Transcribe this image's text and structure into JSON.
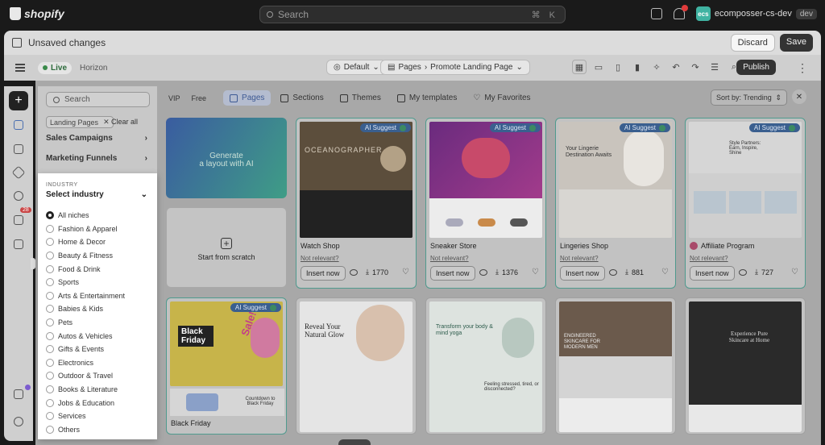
{
  "shopify": {
    "logo_text": "shopify",
    "search_placeholder": "Search",
    "search_shortcut": "⌘ K",
    "store_initials": "ecs",
    "store_name": "ecomposser-cs-dev",
    "env_badge": "dev",
    "notif_count": "1"
  },
  "unsaved": {
    "label": "Unsaved changes",
    "discard": "Discard",
    "save": "Save"
  },
  "editor": {
    "live": "Live",
    "theme": "Horizon",
    "view": "Default",
    "pages": "Pages",
    "page": "Promote Landing Page",
    "publish": "Publish"
  },
  "rail": {
    "badge": "28"
  },
  "filters": {
    "search_placeholder": "Search",
    "chip": "Landing Pages",
    "clear_all": "Clear all",
    "categories": [
      "Sales Campaigns",
      "Marketing Funnels"
    ],
    "industry_label": "INDUSTRY",
    "industry_select": "Select industry",
    "industries": [
      "All niches",
      "Fashion & Apparel",
      "Home & Decor",
      "Beauty & Fitness",
      "Food & Drink",
      "Sports",
      "Arts & Entertainment",
      "Babies & Kids",
      "Pets",
      "Autos & Vehicles",
      "Gifts & Events",
      "Electronics",
      "Outdoor & Travel",
      "Books & Literature",
      "Jobs & Education",
      "Services",
      "Others"
    ]
  },
  "tabs": {
    "vip": "VIP",
    "free": "Free",
    "pages": "Pages",
    "sections": "Sections",
    "themes": "Themes",
    "my_templates": "My templates",
    "my_favorites": "My Favorites",
    "sort_by": "Sort by:",
    "sort_value": "Trending"
  },
  "cards": {
    "generate": "Generate\na layout with AI",
    "scratch": "Start from scratch",
    "ai_suggest": "AI Suggest",
    "not_relevant": "Not relevant?",
    "insert": "Insert now",
    "items": [
      {
        "name": "Watch Shop",
        "count": "1770"
      },
      {
        "name": "Sneaker Store",
        "count": "1376"
      },
      {
        "name": "Lingeries Shop",
        "count": "881"
      },
      {
        "name": "Affiliate Program",
        "count": "727"
      }
    ],
    "row2": [
      {
        "name": "Black Friday"
      }
    ],
    "thumb_texts": {
      "ocean": "OCEANOGRAPHER",
      "black_friday": "Black Friday",
      "sale": "Sale!",
      "reveal": "Reveal Your Natural Glow",
      "transform": "Transform your body & mind yoga",
      "engineered": "ENGINEERED SKINCARE FOR MODERN MEN",
      "skincare": "Experience Pure Skincare at Home",
      "lingerie": "Your Lingerie Destination Awaits",
      "affiliate": "Style Partners: Earn, Inspire, Shine",
      "countdown": "Countdown to Black Friday",
      "yoga2": "Feeling stressed, tired, or disconnected?"
    }
  },
  "colors": {
    "accent": "#3e5a94",
    "highlight_border": "#4f9a8e",
    "publish": "#333333"
  }
}
